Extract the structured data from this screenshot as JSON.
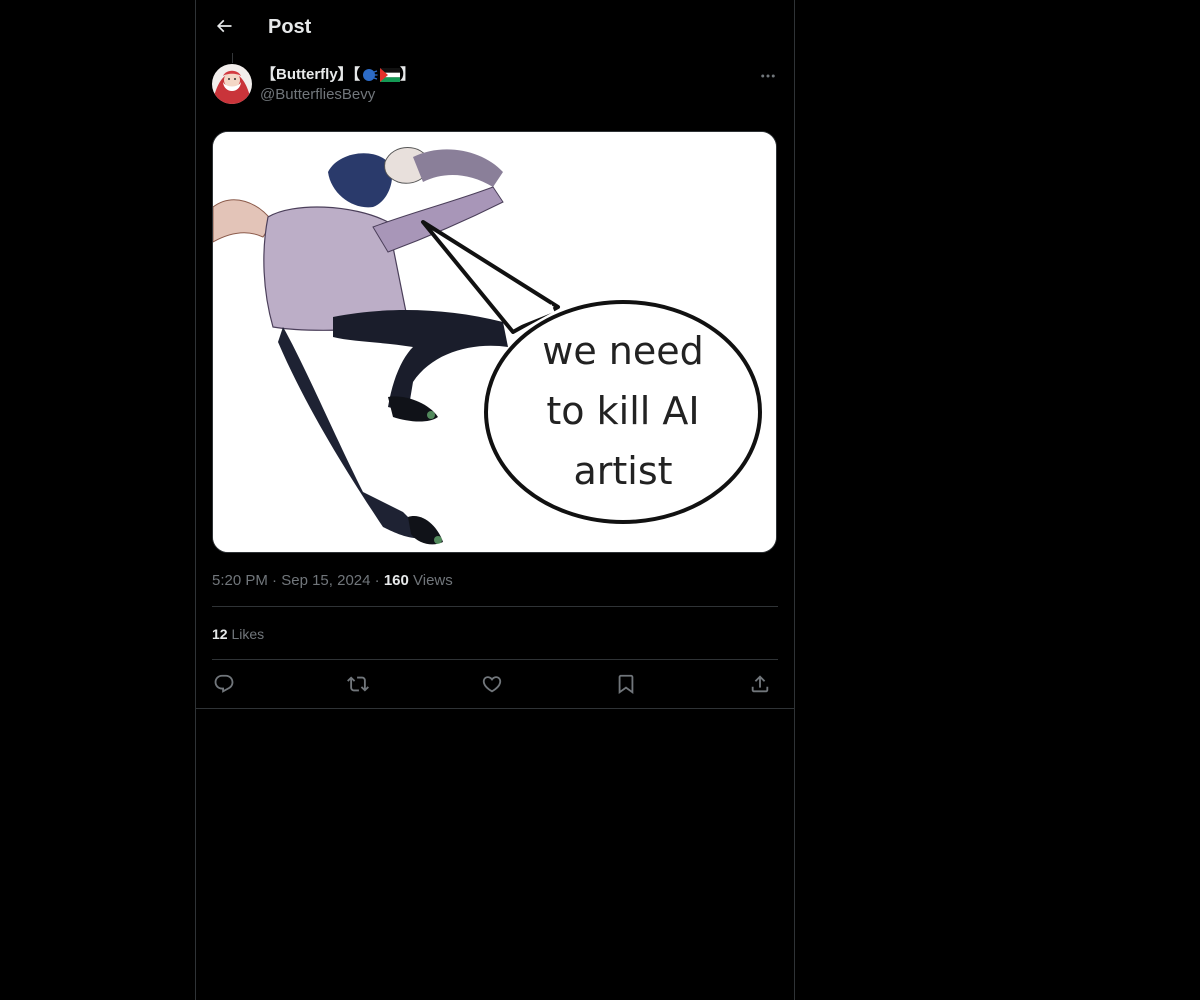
{
  "header": {
    "title": "Post",
    "back_icon": "arrow-left-icon"
  },
  "post": {
    "author": {
      "display_name": "【Butterfly】【",
      "display_name_suffix": "】",
      "emoji_icons": [
        "speaking-head-emoji",
        "palestine-flag-emoji"
      ],
      "handle": "@ButterfliesBevy",
      "avatar_icon": "avatar-image"
    },
    "more_icon": "more-dots-icon",
    "media": {
      "speech_bubble_lines": [
        "we need",
        "to kill AI",
        "artist"
      ]
    },
    "time": "5:20 PM",
    "date": "Sep 15, 2024",
    "separator": "·",
    "views_count": "160",
    "views_label": "Views",
    "likes_count": "12",
    "likes_label": "Likes"
  },
  "actions": [
    {
      "name": "reply",
      "icon": "reply-icon"
    },
    {
      "name": "repost",
      "icon": "repost-icon"
    },
    {
      "name": "like",
      "icon": "heart-icon"
    },
    {
      "name": "bookmark",
      "icon": "bookmark-icon"
    },
    {
      "name": "share",
      "icon": "share-icon"
    }
  ],
  "colors": {
    "background": "#000000",
    "border": "#2f3336",
    "text_primary": "#e7e9ea",
    "text_secondary": "#71767b"
  }
}
